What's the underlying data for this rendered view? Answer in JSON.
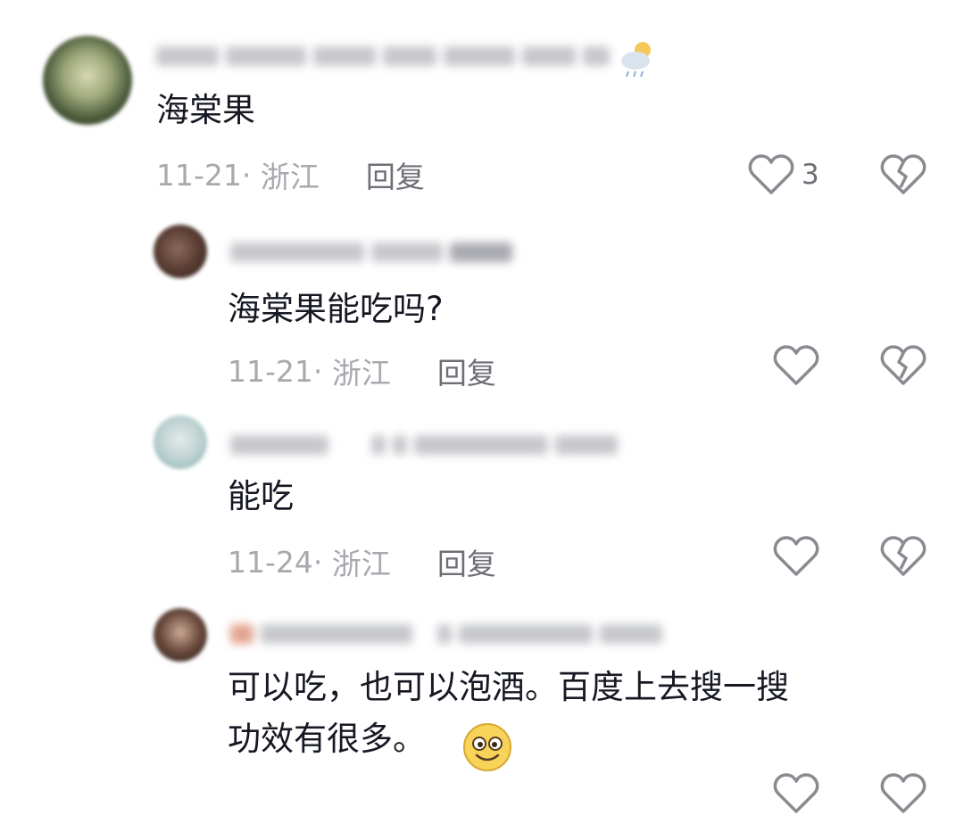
{
  "comments": [
    {
      "content": "海棠果",
      "date": "11-21",
      "location": "浙江",
      "reply_label": "回复",
      "like_count": "3"
    },
    {
      "content": "海棠果能吃吗?",
      "date": "11-21",
      "location": "浙江",
      "reply_label": "回复",
      "like_count": ""
    },
    {
      "content": "能吃",
      "date": "11-24",
      "location": "浙江",
      "reply_label": "回复",
      "like_count": ""
    },
    {
      "content": "可以吃，也可以泡酒。百度上去搜一搜\n功效有很多。",
      "date": "",
      "location": "",
      "reply_label": "",
      "like_count": ""
    }
  ],
  "icons": {
    "like": "heart-outline-icon",
    "dislike": "broken-heart-icon",
    "emoji": "smiley-emoji-icon",
    "weather": "weather-cloud-sun-icon"
  },
  "colors": {
    "text": "#161823",
    "meta": "#a8a9ae",
    "reply": "#6e6f76",
    "icon": "#8a8b91"
  }
}
